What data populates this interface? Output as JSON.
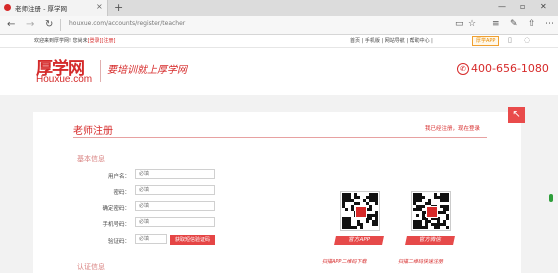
{
  "browser": {
    "tab_title": "老师注册 - 厚学网",
    "tab_close": "×",
    "new_tab": "+",
    "url": "houxue.com/accounts/register/teacher",
    "nav": {
      "back": "←",
      "forward": "→",
      "refresh": "↻"
    },
    "toolbar_icons": [
      "reading-view-icon",
      "favorites-star-icon",
      "hub-icon",
      "web-note-icon",
      "share-icon",
      "more-icon"
    ],
    "window_controls": {
      "minimize": "—",
      "restore": "▫",
      "close": "✕"
    }
  },
  "site_top": {
    "welcome": "欢迎来到厚学网! 您尚未",
    "login": "[登录]",
    "register": "[注册]",
    "links": "首页 | 手机版 | 网站导航 | 帮助中心 |",
    "app_badge": "厚学APP"
  },
  "header": {
    "logo_cn": "厚学网",
    "logo_en": "Houxue.com",
    "slogan": "要培训就上厚学网",
    "phone": "400-656-1080",
    "phone_icon": "phone-circle-icon"
  },
  "form": {
    "title": "老师注册",
    "login_prompt": "我已经注册，现在登录",
    "back_to_top": "↖",
    "section_basic": "基本信息",
    "section_auth": "认证信息",
    "fields": [
      {
        "label": "用户名：",
        "placeholder": "必填"
      },
      {
        "label": "密码：",
        "placeholder": "必填"
      },
      {
        "label": "确定密码：",
        "placeholder": "必填"
      },
      {
        "label": "手机号码：",
        "placeholder": "必填"
      },
      {
        "label": "验证码：",
        "placeholder": "必填"
      }
    ],
    "sms_button": "获取短信验证码"
  },
  "qr": {
    "items": [
      {
        "ribbon": "官方APP",
        "caption": "扫描APP二维码下载"
      },
      {
        "ribbon": "官方微信",
        "caption": "扫描二维码快速注册"
      }
    ],
    "accent": "#e64a4a"
  },
  "colors": {
    "brand_red": "#d62a2a",
    "section_pink": "#d8807f"
  }
}
